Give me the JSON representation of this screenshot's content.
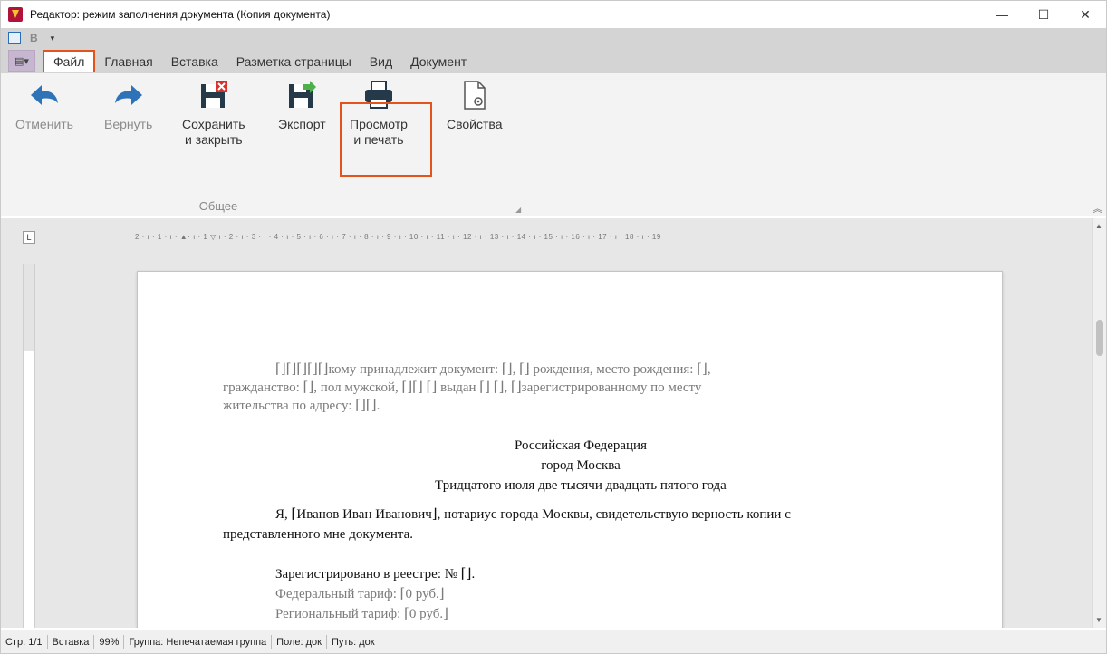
{
  "window": {
    "title": "Редактор: режим заполнения документа (Копия документа)",
    "controls": [
      "—",
      "☐",
      "✕"
    ]
  },
  "qat": {
    "bold_label": "B",
    "dropdown": "▾"
  },
  "tabs": [
    "Файл",
    "Главная",
    "Вставка",
    "Разметка страницы",
    "Вид",
    "Документ"
  ],
  "active_tab": "Файл",
  "ribbon": {
    "buttons": {
      "undo": "Отменить",
      "redo": "Вернуть",
      "save_close_1": "Сохранить",
      "save_close_2": "и закрыть",
      "export": "Экспорт",
      "print_1": "Просмотр",
      "print_2": "и печать",
      "properties": "Свойства"
    },
    "group_label": "Общее"
  },
  "ruler": {
    "corner": "L",
    "h_text": "2 · ı · 1 · ı · ▲· ı · 1 ▽ ı · 2 · ı · 3 · ı · 4 · ı · 5 · ı · 6 · ı · 7 · ı · 8 · ı · 9 · ı · 10 · ı · 11 · ı · 12 · ı · 13 · ı · 14 · ı · 15 · ı · 16 · ı · 17 · ı · 18 · ı · 19"
  },
  "document": {
    "header_line1": "⌈⌋⌈⌋⌈⌋⌈⌋⌈⌋кому принадлежит документ: ⌈⌋, ⌈⌋ рождения, место рождения: ⌈⌋,",
    "header_line2": "гражданство: ⌈⌋, пол мужской, ⌈⌋⌈⌋ ⌈⌋ выдан ⌈⌋ ⌈⌋, ⌈⌋зарегистрированному по месту",
    "header_line3": "жительства по адресу: ⌈⌋⌈⌋.",
    "country": "Российская Федерация",
    "city": "город Москва",
    "date": "Тридцатого июля две тысячи двадцать пятого года",
    "body_line1": "Я, ⌈Иванов Иван Иванович⌋, нотариус города Москвы, свидетельствую верность копии с",
    "body_line2": "представленного мне документа.",
    "registry": "Зарегистрировано в реестре: № ⌈⌋.",
    "federal_tariff": "Федеральный тариф: ⌈0 руб.⌋",
    "regional_tariff": "Региональный тариф: ⌈0 руб.⌋"
  },
  "status": [
    "Стр. 1/1",
    "Вставка",
    "99%",
    "Группа: Непечатаемая группа",
    "Поле: док",
    "Путь: док"
  ],
  "colors": {
    "highlight": "#e2541c",
    "arrow_blue": "#2e73b8",
    "ribbon_bg": "#f3f3f3"
  }
}
